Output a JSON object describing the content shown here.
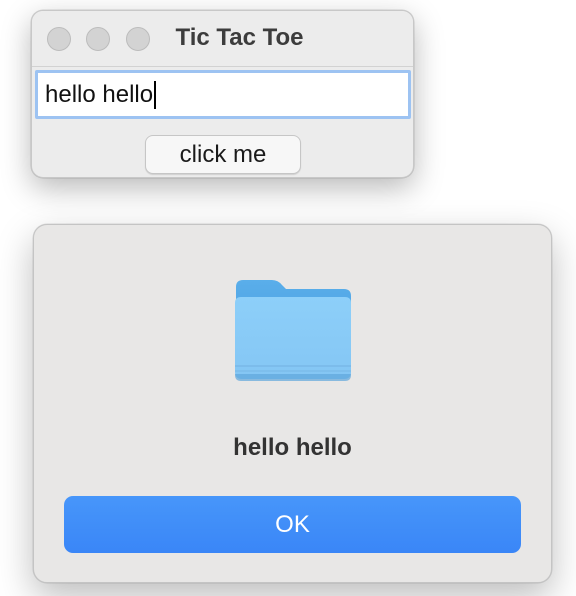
{
  "window": {
    "title": "Tic Tac Toe",
    "text_field_value": "hello hello",
    "button_label": "click me"
  },
  "alert": {
    "icon": "folder-icon",
    "message": "hello hello",
    "ok_label": "OK"
  },
  "colors": {
    "accent": "#3a86f7",
    "folder_front": "#8bcdf8",
    "folder_back": "#4ea7ea"
  }
}
